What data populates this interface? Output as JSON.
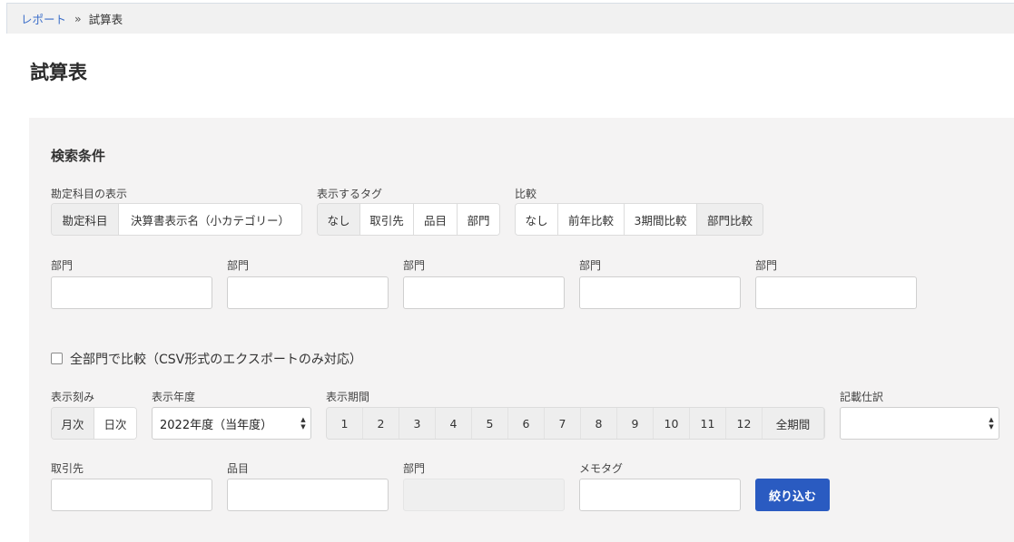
{
  "breadcrumb": {
    "parent": "レポート",
    "separator": "»",
    "current": "試算表"
  },
  "page_title": "試算表",
  "search": {
    "title": "検索条件",
    "account_display": {
      "label": "勘定科目の表示",
      "options": [
        "勘定科目",
        "決算書表示名（小カテゴリー）"
      ],
      "selected": "勘定科目"
    },
    "tag_display": {
      "label": "表示するタグ",
      "options": [
        "なし",
        "取引先",
        "品目",
        "部門"
      ],
      "selected": "なし"
    },
    "compare": {
      "label": "比較",
      "options": [
        "なし",
        "前年比較",
        "3期間比較",
        "部門比較"
      ],
      "selected": "部門比較"
    },
    "departments": [
      {
        "label": "部門",
        "value": ""
      },
      {
        "label": "部門",
        "value": ""
      },
      {
        "label": "部門",
        "value": ""
      },
      {
        "label": "部門",
        "value": ""
      },
      {
        "label": "部門",
        "value": ""
      }
    ],
    "all_departments_checkbox": {
      "label": "全部門で比較（CSV形式のエクスポートのみ対応）",
      "checked": false
    },
    "granularity": {
      "label": "表示刻み",
      "options": [
        "月次",
        "日次"
      ],
      "selected": "月次"
    },
    "fiscal_year": {
      "label": "表示年度",
      "value": "2022年度（当年度）"
    },
    "period": {
      "label": "表示期間",
      "months": [
        "1",
        "2",
        "3",
        "4",
        "5",
        "6",
        "7",
        "8",
        "9",
        "10",
        "11",
        "12",
        "全期間"
      ]
    },
    "journal": {
      "label": "記載仕訳",
      "value": ""
    },
    "partner": {
      "label": "取引先",
      "value": ""
    },
    "item": {
      "label": "品目",
      "value": ""
    },
    "section": {
      "label": "部門",
      "value": ""
    },
    "memo_tag": {
      "label": "メモタグ",
      "value": ""
    },
    "filter_button": "絞り込む"
  },
  "colors": {
    "primary": "#2a5bc1",
    "link": "#3d6fc9",
    "panel": "#f4f3f3"
  }
}
